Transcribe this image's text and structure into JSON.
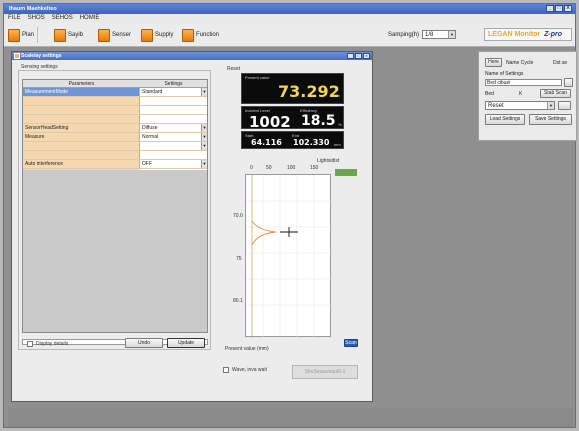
{
  "app": {
    "title": "Ihaum Maehkelteo",
    "window_controls": [
      "_",
      "□",
      "X"
    ]
  },
  "menu": [
    "FILE",
    "SHOS",
    "SEHOS",
    "HOMIE"
  ],
  "toolbar": {
    "buttons": [
      {
        "label": "Plan"
      },
      {
        "label": "Sayib"
      },
      {
        "label": "Senser"
      },
      {
        "label": "Supply"
      },
      {
        "label": "Function"
      }
    ],
    "sampling_label": "Samping(h)",
    "sampling_value": "1/8",
    "brand_name": "LEGAN Monitor",
    "brand_model": "Z-pro"
  },
  "right_panel": {
    "new_button": "Here",
    "name_label": "Name Cycle",
    "name_value": "Dst av",
    "settings_label": "Name of Settings",
    "settings_value": "Bed cibuei",
    "mode_label": "Bed",
    "mode_value": "K",
    "mode_button": "Stab Scan",
    "select_value": "Reset",
    "load_button": "Load Settings",
    "save_button": "Save Settings"
  },
  "dialog": {
    "title": "Scalelay settings",
    "group_label": "Sensing settings",
    "grid_headers": {
      "param": "Parameters",
      "setting": "Settings"
    },
    "rows": [
      {
        "param": "MeasurementMode",
        "setting": "Standard",
        "selected": true
      },
      {
        "param": "",
        "setting": ""
      },
      {
        "param": "",
        "setting": ""
      },
      {
        "param": "",
        "setting": ""
      },
      {
        "param": "SensorHeadSetting",
        "setting": "Diffuse"
      },
      {
        "param": "Measure",
        "setting": "Normal"
      },
      {
        "param": "",
        "setting": ""
      },
      {
        "param": "",
        "setting": ""
      },
      {
        "param": "Auto interference",
        "setting": "OFF"
      },
      {
        "param": "",
        "setting": ""
      }
    ],
    "display_details": "Display details",
    "undo": "Undo",
    "update": "Update",
    "reset_label": "Reset",
    "present_value_caption": "Present value",
    "present_value": "73.292",
    "present_unit": "mm",
    "incident_caption": "Incident Level",
    "incident_value": "1002",
    "efficiency_caption": "Efficiency",
    "efficiency_value": "18.5",
    "efficiency_unit": "%",
    "start_caption": "Start",
    "start_value": "64.116",
    "end_caption": "End",
    "end_value": "102.330",
    "end_unit": "mm",
    "x_ticks": [
      "0",
      "50",
      "100",
      "150"
    ],
    "x_axis_label": "Lightsidist",
    "y_ticks": [
      "70.0",
      "75",
      "80.1"
    ],
    "present_value_footer": "Present value (mm)",
    "scan_button": "Scan",
    "wave_label": "Wave, inva wait",
    "apply_button": "ShoSewaveaut0-1"
  },
  "colors": {
    "accent_orange": "#f5a623",
    "title_blue": "#4a6fc2",
    "grid_peach": "#f6d8b0",
    "marker_green": "#6aa84f"
  }
}
